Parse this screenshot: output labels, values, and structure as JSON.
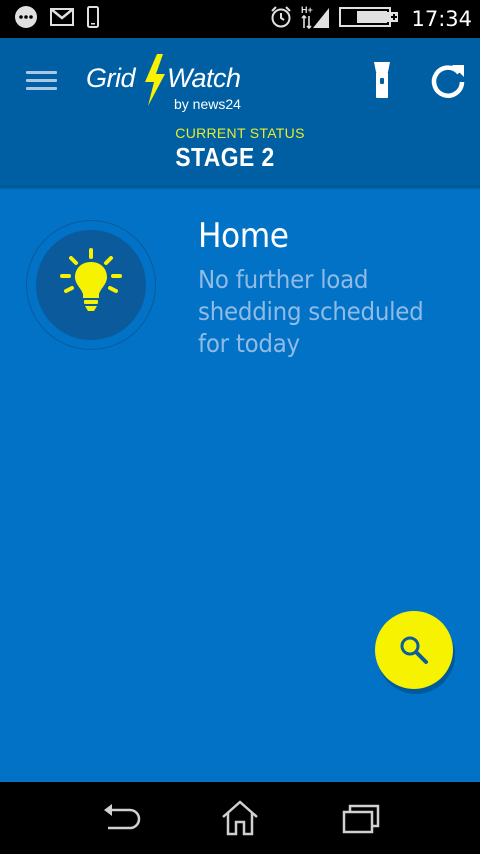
{
  "status_bar": {
    "time": "17:34",
    "network_label": "H+",
    "icons": [
      "chat-icon",
      "gmail-icon",
      "phone-icon",
      "alarm-icon",
      "signal-icon",
      "battery-icon"
    ]
  },
  "app_bar": {
    "logo": {
      "word1": "Grid",
      "word2": "Watch",
      "byline": "by news24"
    },
    "status_label": "CURRENT STATUS",
    "status_value": "STAGE 2",
    "actions": [
      "menu-icon",
      "flashlight-icon",
      "refresh-icon"
    ]
  },
  "area": {
    "name": "Home",
    "message": "No further load shedding scheduled for today",
    "icon": "lightbulb-icon"
  },
  "fab": {
    "icon": "search-icon"
  },
  "nav_bar": {
    "buttons": [
      "back-icon",
      "home-icon",
      "recents-icon"
    ]
  },
  "colors": {
    "background": "#0172c6",
    "app_bar": "#005fa3",
    "accent_yellow": "#f7f200",
    "status_label": "#e6ec2e",
    "message_text": "#8fbbe6"
  }
}
